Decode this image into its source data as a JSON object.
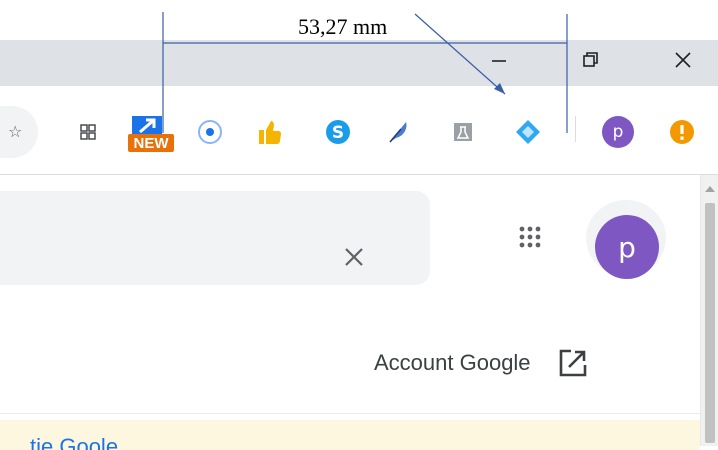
{
  "annotation": {
    "measurement": "53,27 mm"
  },
  "window": {
    "minimize_icon": "minimize-icon",
    "restore_icon": "restore-icon",
    "close_icon": "close-icon"
  },
  "toolbar": {
    "extensions": [
      {
        "name": "tab-grid-extension",
        "icon": "grid-icon"
      },
      {
        "name": "new-link-extension",
        "icon": "arrow-new-icon",
        "badge": "NEW"
      },
      {
        "name": "record-extension",
        "icon": "circle-dot-icon"
      },
      {
        "name": "thumbs-up-extension",
        "icon": "thumbs-up-icon"
      },
      {
        "name": "skype-extension",
        "icon": "skype-icon"
      },
      {
        "name": "feather-extension",
        "icon": "feather-icon"
      },
      {
        "name": "flask-extension",
        "icon": "flask-icon"
      },
      {
        "name": "diamond-extension",
        "icon": "diamond-icon"
      }
    ],
    "profile_letter": "p",
    "alert_icon": "exclamation-icon"
  },
  "page": {
    "profile_letter": "p",
    "account_label": "Account Google",
    "banner_text": "ti⁠e Goo⁠le"
  },
  "colors": {
    "titlebar": "#dee1e6",
    "profile": "#7e57c2",
    "alert": "#f29900",
    "annotation_line": "#3a5fa8"
  }
}
